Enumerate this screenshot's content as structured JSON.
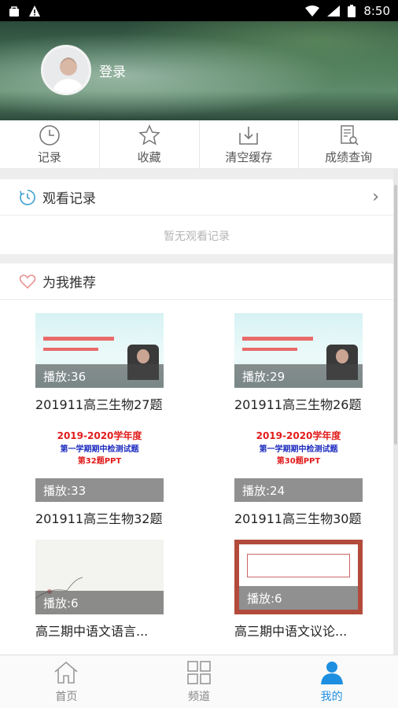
{
  "status_bar": {
    "time": "8:50"
  },
  "profile": {
    "login_label": "登录"
  },
  "quick_actions": [
    {
      "label": "记录",
      "icon": "clock-icon"
    },
    {
      "label": "收藏",
      "icon": "star-icon"
    },
    {
      "label": "清空缓存",
      "icon": "download-clear-icon"
    },
    {
      "label": "成绩查询",
      "icon": "document-search-icon"
    }
  ],
  "history": {
    "title": "观看记录",
    "empty_text": "暂无观看记录"
  },
  "recommend": {
    "title": "为我推荐",
    "items": [
      {
        "title": "201911高三生物27题",
        "plays": "播放:36"
      },
      {
        "title": "201911高三生物26题",
        "plays": "播放:29"
      },
      {
        "title": "201911高三生物32题",
        "plays": "播放:33",
        "thumb_lines": [
          "2019-2020学年度",
          "第一学期期中检测试题",
          "第32题PPT"
        ]
      },
      {
        "title": "201911高三生物30题",
        "plays": "播放:24",
        "thumb_lines": [
          "2019-2020学年度",
          "第一学期期中检测试题",
          "第30题PPT"
        ]
      },
      {
        "title": "高三期中语文语言...",
        "plays": "播放:6"
      },
      {
        "title": "高三期中语文议论...",
        "plays": "播放:6"
      }
    ]
  },
  "bottom_nav": [
    {
      "label": "首页",
      "icon": "home-icon"
    },
    {
      "label": "频道",
      "icon": "grid-icon"
    },
    {
      "label": "我的",
      "icon": "person-icon"
    }
  ],
  "colors": {
    "active": "#1e8fe0",
    "accent_cyan": "#3aa0d0",
    "heart": "#e88a8a"
  }
}
